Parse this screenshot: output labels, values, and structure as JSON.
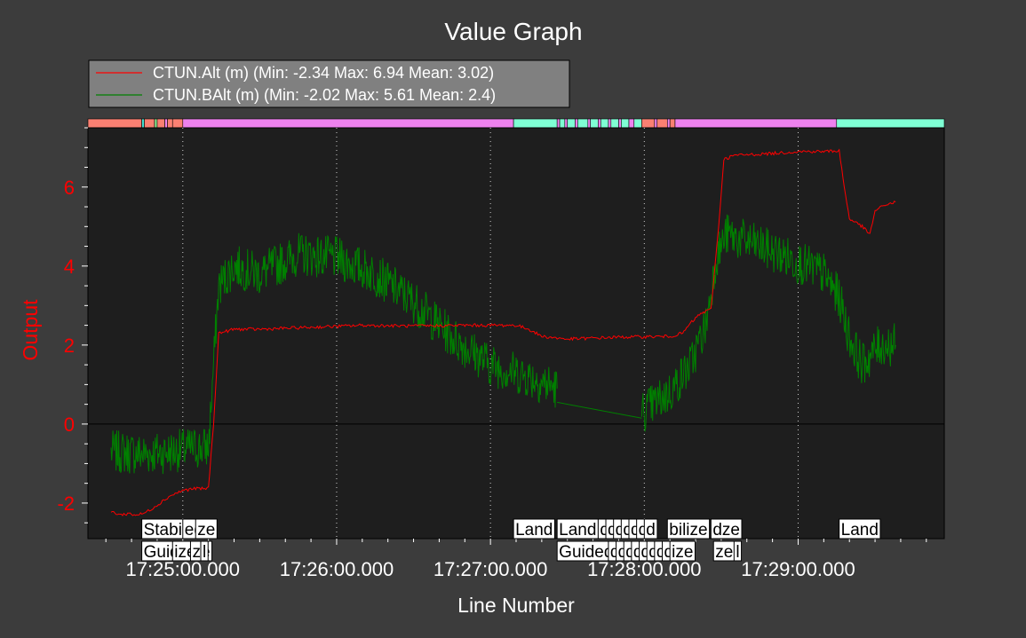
{
  "window": {
    "title": "Value Graph"
  },
  "colors": {
    "background": "#3c3c3c",
    "plot_background": "#1e1e1e",
    "text": "#ffffff",
    "y_axis": "#ff0000",
    "series_alt": "#ff0000",
    "series_balt": "#008000"
  },
  "chart_data": {
    "type": "line",
    "title": "Value Graph",
    "xlabel": "Line Number",
    "ylabel": "Output",
    "xlim": [
      "17:24:23",
      "17:29:57"
    ],
    "ylim": [
      -2.9,
      7.5
    ],
    "y_ticks": [
      -2,
      0,
      2,
      4,
      6
    ],
    "y_tick_labels": [
      "-2",
      "0",
      "2",
      "4",
      "6"
    ],
    "x_ticks": [
      "17:25:00",
      "17:26:00",
      "17:27:00",
      "17:28:00",
      "17:29:00"
    ],
    "x_tick_labels": [
      "17:25:00.000",
      "17:26:00.000",
      "17:27:00.000",
      "17:28:00.000",
      "17:29:00.000"
    ],
    "grid": "vertical dotted",
    "legend_position": "top-left",
    "series": [
      {
        "name": "CTUN.Alt (m) (Min: -2.34 Max: 6.94 Mean: 3.02)",
        "color": "#ff0000",
        "noise": 0.04,
        "points": [
          [
            "17:24:32",
            -2.22
          ],
          [
            "17:24:36",
            -2.3
          ],
          [
            "17:24:39",
            -2.26
          ],
          [
            "17:24:41",
            -2.3
          ],
          [
            "17:24:44",
            -2.28
          ],
          [
            "17:24:46",
            -2.22
          ],
          [
            "17:24:50",
            -2.05
          ],
          [
            "17:24:55",
            -1.82
          ],
          [
            "17:25:00",
            -1.68
          ],
          [
            "17:25:05",
            -1.63
          ],
          [
            "17:25:08",
            -1.64
          ],
          [
            "17:25:10",
            -1.62
          ],
          [
            "17:25:12",
            0.0
          ],
          [
            "17:25:14",
            2.3
          ],
          [
            "17:25:20",
            2.4
          ],
          [
            "17:25:30",
            2.4
          ],
          [
            "17:25:50",
            2.45
          ],
          [
            "17:26:10",
            2.5
          ],
          [
            "17:26:30",
            2.48
          ],
          [
            "17:26:50",
            2.5
          ],
          [
            "17:27:10",
            2.5
          ],
          [
            "17:27:15",
            2.4
          ],
          [
            "17:27:20",
            2.22
          ],
          [
            "17:27:30",
            2.15
          ],
          [
            "17:27:50",
            2.2
          ],
          [
            "17:28:10",
            2.22
          ],
          [
            "17:28:15",
            2.3
          ],
          [
            "17:28:18",
            2.55
          ],
          [
            "17:28:22",
            2.8
          ],
          [
            "17:28:26",
            2.9
          ],
          [
            "17:28:29",
            5.0
          ],
          [
            "17:28:31",
            6.7
          ],
          [
            "17:28:35",
            6.8
          ],
          [
            "17:28:50",
            6.85
          ],
          [
            "17:29:00",
            6.9
          ],
          [
            "17:29:10",
            6.9
          ],
          [
            "17:29:16",
            6.92
          ],
          [
            "17:29:18",
            6.0
          ],
          [
            "17:29:20",
            5.2
          ],
          [
            "17:29:25",
            5.0
          ],
          [
            "17:29:28",
            4.8
          ],
          [
            "17:29:30",
            5.4
          ],
          [
            "17:29:34",
            5.55
          ],
          [
            "17:29:38",
            5.62
          ]
        ]
      },
      {
        "name": "CTUN.BAlt (m) (Min: -2.02 Max: 5.61 Mean: 2.4)",
        "color": "#008000",
        "noise": 0.55,
        "segments": [
          [
            [
              "17:24:32",
              -0.7
            ],
            [
              "17:24:45",
              -0.75
            ],
            [
              "17:24:55",
              -0.7
            ],
            [
              "17:25:05",
              -0.6
            ],
            [
              "17:25:10",
              -0.6
            ],
            [
              "17:25:12",
              1.5
            ],
            [
              "17:25:14",
              3.5
            ],
            [
              "17:25:20",
              4.0
            ],
            [
              "17:25:30",
              3.8
            ],
            [
              "17:25:45",
              4.3
            ],
            [
              "17:26:00",
              4.2
            ],
            [
              "17:26:15",
              3.8
            ],
            [
              "17:26:30",
              3.1
            ],
            [
              "17:26:45",
              2.2
            ],
            [
              "17:27:00",
              1.5
            ],
            [
              "17:27:15",
              1.2
            ],
            [
              "17:27:26",
              0.9
            ]
          ],
          [
            [
              "17:27:26",
              0.55
            ],
            [
              "17:27:59",
              0.15
            ]
          ],
          [
            [
              "17:27:59",
              0.3
            ],
            [
              "17:28:10",
              0.8
            ],
            [
              "17:28:18",
              1.5
            ],
            [
              "17:28:24",
              2.5
            ],
            [
              "17:28:28",
              4.2
            ],
            [
              "17:28:32",
              4.8
            ],
            [
              "17:28:45",
              4.5
            ],
            [
              "17:29:00",
              4.1
            ],
            [
              "17:29:10",
              3.8
            ],
            [
              "17:29:16",
              3.2
            ],
            [
              "17:29:20",
              2.2
            ],
            [
              "17:29:25",
              1.5
            ],
            [
              "17:29:32",
              2.0
            ],
            [
              "17:29:38",
              2.0
            ]
          ]
        ]
      }
    ],
    "mode_bar": [
      {
        "start": "17:24:23",
        "end": "17:24:44",
        "color": "#fa8072"
      },
      {
        "start": "17:24:44",
        "end": "17:24:45",
        "color": "#40e0d0"
      },
      {
        "start": "17:24:45",
        "end": "17:24:49",
        "color": "#fa8072"
      },
      {
        "start": "17:24:49",
        "end": "17:24:50",
        "color": "#90ee90"
      },
      {
        "start": "17:24:50",
        "end": "17:24:53",
        "color": "#fa8072"
      },
      {
        "start": "17:24:53",
        "end": "17:24:54",
        "color": "#ee82ee"
      },
      {
        "start": "17:24:54",
        "end": "17:24:56",
        "color": "#fa8072"
      },
      {
        "start": "17:24:56",
        "end": "17:25:00",
        "color": "#fa8072"
      },
      {
        "start": "17:25:00",
        "end": "17:27:09",
        "color": "#ee82ee"
      },
      {
        "start": "17:27:09",
        "end": "17:27:26",
        "color": "#7fffd4"
      },
      {
        "start": "17:27:26",
        "end": "17:27:27",
        "color": "#ee82ee"
      },
      {
        "start": "17:27:27",
        "end": "17:27:29",
        "color": "#7fffd4"
      },
      {
        "start": "17:27:29",
        "end": "17:27:30",
        "color": "#ee82ee"
      },
      {
        "start": "17:27:30",
        "end": "17:27:33",
        "color": "#7fffd4"
      },
      {
        "start": "17:27:33",
        "end": "17:27:34",
        "color": "#ee82ee"
      },
      {
        "start": "17:27:34",
        "end": "17:27:38",
        "color": "#7fffd4"
      },
      {
        "start": "17:27:38",
        "end": "17:27:39",
        "color": "#ee82ee"
      },
      {
        "start": "17:27:39",
        "end": "17:27:42",
        "color": "#7fffd4"
      },
      {
        "start": "17:27:42",
        "end": "17:27:43",
        "color": "#ee82ee"
      },
      {
        "start": "17:27:43",
        "end": "17:27:46",
        "color": "#7fffd4"
      },
      {
        "start": "17:27:46",
        "end": "17:27:47",
        "color": "#ee82ee"
      },
      {
        "start": "17:27:47",
        "end": "17:27:50",
        "color": "#7fffd4"
      },
      {
        "start": "17:27:50",
        "end": "17:27:51",
        "color": "#ee82ee"
      },
      {
        "start": "17:27:51",
        "end": "17:27:54",
        "color": "#7fffd4"
      },
      {
        "start": "17:27:54",
        "end": "17:27:56",
        "color": "#ee82ee"
      },
      {
        "start": "17:27:56",
        "end": "17:27:59",
        "color": "#7fffd4"
      },
      {
        "start": "17:27:59",
        "end": "17:28:04",
        "color": "#fa8072"
      },
      {
        "start": "17:28:04",
        "end": "17:28:05",
        "color": "#ee82ee"
      },
      {
        "start": "17:28:05",
        "end": "17:28:09",
        "color": "#fa8072"
      },
      {
        "start": "17:28:09",
        "end": "17:28:10",
        "color": "#ee82ee"
      },
      {
        "start": "17:28:10",
        "end": "17:28:12",
        "color": "#fa8072"
      },
      {
        "start": "17:28:12",
        "end": "17:29:15",
        "color": "#ee82ee"
      },
      {
        "start": "17:29:15",
        "end": "17:29:57",
        "color": "#7fffd4"
      }
    ],
    "mode_labels": [
      {
        "text": "Stabilize",
        "time": "17:24:44",
        "row": 1
      },
      {
        "text": "ed",
        "time": "17:25:00",
        "row": 1
      },
      {
        "text": "ze",
        "time": "17:25:05",
        "row": 1
      },
      {
        "text": "Guided",
        "time": "17:24:44",
        "row": 2
      },
      {
        "text": "ize",
        "time": "17:24:56",
        "row": 2
      },
      {
        "text": "ze",
        "time": "17:25:03",
        "row": 2
      },
      {
        "text": "l",
        "time": "17:25:07",
        "row": 2
      },
      {
        "text": "Land",
        "time": "17:27:09",
        "row": 1
      },
      {
        "text": "Land",
        "time": "17:27:26",
        "row": 1
      },
      {
        "text": "d",
        "time": "17:27:42",
        "row": 1
      },
      {
        "text": "d",
        "time": "17:27:45",
        "row": 1
      },
      {
        "text": "d",
        "time": "17:27:48",
        "row": 1
      },
      {
        "text": "d",
        "time": "17:27:51",
        "row": 1
      },
      {
        "text": "d",
        "time": "17:27:54",
        "row": 1
      },
      {
        "text": "d",
        "time": "17:27:57",
        "row": 1
      },
      {
        "text": "d",
        "time": "17:28:00",
        "row": 1
      },
      {
        "text": "bilize",
        "time": "17:28:09",
        "row": 1
      },
      {
        "text": "dze",
        "time": "17:28:26",
        "row": 1
      },
      {
        "text": "Guided",
        "time": "17:27:26",
        "row": 2
      },
      {
        "text": "d",
        "time": "17:27:46",
        "row": 2
      },
      {
        "text": "d",
        "time": "17:27:49",
        "row": 2
      },
      {
        "text": "d",
        "time": "17:27:52",
        "row": 2
      },
      {
        "text": "d",
        "time": "17:27:55",
        "row": 2
      },
      {
        "text": "d",
        "time": "17:27:58",
        "row": 2
      },
      {
        "text": "d",
        "time": "17:28:01",
        "row": 2
      },
      {
        "text": "d",
        "time": "17:28:04",
        "row": 2
      },
      {
        "text": "d",
        "time": "17:28:07",
        "row": 2
      },
      {
        "text": "ize",
        "time": "17:28:10",
        "row": 2
      },
      {
        "text": "ze",
        "time": "17:28:27",
        "row": 2
      },
      {
        "text": "l",
        "time": "17:28:35",
        "row": 2
      },
      {
        "text": "Land",
        "time": "17:29:16",
        "row": 1
      }
    ]
  }
}
